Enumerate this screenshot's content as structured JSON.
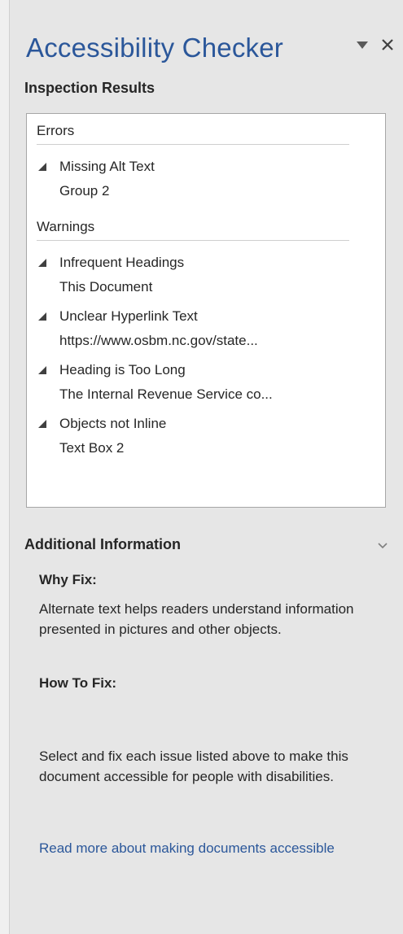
{
  "pane": {
    "title": "Accessibility Checker",
    "controls": {
      "dropdown_icon": "triangle-down-icon",
      "close_icon": "close-icon"
    },
    "accent_color": "#2b579a"
  },
  "inspection": {
    "heading": "Inspection Results",
    "groups": [
      {
        "label": "Errors",
        "issues": [
          {
            "title": "Missing Alt Text",
            "item": "Group 2"
          }
        ]
      },
      {
        "label": "Warnings",
        "issues": [
          {
            "title": "Infrequent Headings",
            "item": "This Document"
          },
          {
            "title": "Unclear Hyperlink Text",
            "item": "https://www.osbm.nc.gov/state..."
          },
          {
            "title": "Heading is Too Long",
            "item": "The Internal Revenue Service co..."
          },
          {
            "title": "Objects not Inline",
            "item": "Text Box 2"
          }
        ]
      }
    ]
  },
  "additional": {
    "heading": "Additional Information",
    "why_label": "Why Fix:",
    "why_text": "Alternate text helps readers understand information presented in pictures and other objects.",
    "how_label": "How To Fix:",
    "how_text": "Select and fix each issue listed above to make this document accessible for people with disabilities.",
    "read_more": "Read more about making documents accessible"
  }
}
